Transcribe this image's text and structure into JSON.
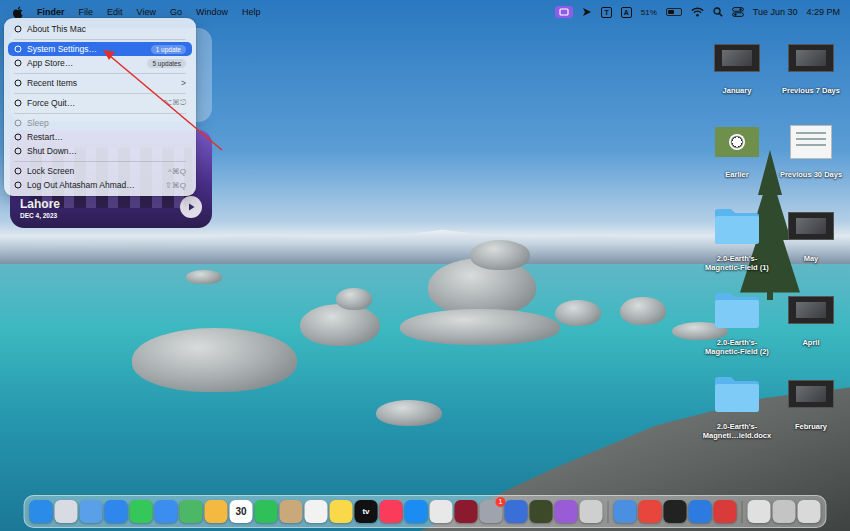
{
  "menu_bar": {
    "app_name": "Finder",
    "menus": [
      "File",
      "Edit",
      "View",
      "Go",
      "Window",
      "Help"
    ],
    "apple_menu_open": true,
    "status": {
      "input_sources": [
        "T",
        "A"
      ],
      "battery": "51%",
      "battery_level": 0.51,
      "date": "Tue Jun 30",
      "time": "4:29 PM"
    }
  },
  "apple_menu": {
    "groups": [
      [
        {
          "label": "About This Mac",
          "selected": false,
          "disabled": false,
          "badge": "",
          "shortcut": "",
          "arrow": ""
        }
      ],
      [
        {
          "label": "System Settings…",
          "selected": true,
          "disabled": false,
          "badge": "1 update",
          "shortcut": "",
          "arrow": ""
        },
        {
          "label": "App Store…",
          "selected": false,
          "disabled": false,
          "badge": "5 updates",
          "shortcut": "",
          "arrow": ""
        }
      ],
      [
        {
          "label": "Recent Items",
          "selected": false,
          "disabled": false,
          "badge": "",
          "shortcut": "",
          "arrow": ">"
        }
      ],
      [
        {
          "label": "Force Quit…",
          "selected": false,
          "disabled": false,
          "badge": "",
          "shortcut": "⌥⌘⎋",
          "arrow": ""
        }
      ],
      [
        {
          "label": "Sleep",
          "selected": false,
          "disabled": true,
          "badge": "",
          "shortcut": "",
          "arrow": ""
        },
        {
          "label": "Restart…",
          "selected": false,
          "disabled": false,
          "badge": "",
          "shortcut": "",
          "arrow": ""
        },
        {
          "label": "Shut Down…",
          "selected": false,
          "disabled": false,
          "badge": "",
          "shortcut": "",
          "arrow": ""
        }
      ],
      [
        {
          "label": "Lock Screen",
          "selected": false,
          "disabled": false,
          "badge": "",
          "shortcut": "^⌘Q",
          "arrow": ""
        },
        {
          "label": "Log Out Ahtasham Ahmad…",
          "selected": false,
          "disabled": false,
          "badge": "",
          "shortcut": "⇧⌘Q",
          "arrow": ""
        }
      ]
    ]
  },
  "widget": {
    "title": "Lahore",
    "date": "DEC 4, 2023"
  },
  "desktop_icons": [
    {
      "label": "January",
      "kind": "video"
    },
    {
      "label": "Previous 7 Days",
      "kind": "video"
    },
    {
      "label": "Earlier",
      "kind": "photo"
    },
    {
      "label": "Previous 30 Days",
      "kind": "document"
    },
    {
      "label": "2.0-Earth's-Magnetic-Field (1)",
      "kind": "folder"
    },
    {
      "label": "May",
      "kind": "video"
    },
    {
      "label": "2.0-Earth's-Magnetic-Field (2)",
      "kind": "folder"
    },
    {
      "label": "April",
      "kind": "video"
    },
    {
      "label": "2.0-Earth's-Magneti…ield.docx",
      "kind": "folder"
    },
    {
      "label": "February",
      "kind": "video"
    }
  ],
  "dock": {
    "apps": [
      {
        "color": "#2a8ce8",
        "text": "",
        "badge": ""
      },
      {
        "color": "#d9dbe2",
        "text": "",
        "badge": ""
      },
      {
        "color": "#5aa0e8",
        "text": "",
        "badge": ""
      },
      {
        "color": "#2f86ec",
        "text": "",
        "badge": ""
      },
      {
        "color": "#35c759",
        "text": "",
        "badge": ""
      },
      {
        "color": "#3b8ef0",
        "text": "",
        "badge": ""
      },
      {
        "color": "#4cb865",
        "text": "",
        "badge": ""
      },
      {
        "color": "#f4b940",
        "text": "",
        "badge": ""
      },
      {
        "color": "#ffffff",
        "text": "30",
        "badge": ""
      },
      {
        "color": "#2fc05a",
        "text": "",
        "badge": ""
      },
      {
        "color": "#c9a97a",
        "text": "",
        "badge": ""
      },
      {
        "color": "#f2f2f2",
        "text": "",
        "badge": ""
      },
      {
        "color": "#f9d94a",
        "text": "",
        "badge": ""
      },
      {
        "color": "#111111",
        "text": "tv",
        "badge": ""
      },
      {
        "color": "#fa3c5a",
        "text": "",
        "badge": ""
      },
      {
        "color": "#1b8df2",
        "text": "",
        "badge": ""
      },
      {
        "color": "#e8e8e8",
        "text": "",
        "badge": ""
      },
      {
        "color": "#8c1a2e",
        "text": "",
        "badge": ""
      },
      {
        "color": "#9ea3ad",
        "text": "",
        "badge": "1"
      },
      {
        "color": "#3b6fd8",
        "text": "",
        "badge": ""
      },
      {
        "color": "#3d4a2a",
        "text": "",
        "badge": ""
      },
      {
        "color": "#9a5cd6",
        "text": "",
        "badge": ""
      },
      {
        "color": "#cfcfcf",
        "text": "",
        "badge": ""
      }
    ],
    "recent": [
      {
        "color": "#4a8fe0",
        "text": "",
        "badge": ""
      },
      {
        "color": "#e8453c",
        "text": "",
        "badge": ""
      },
      {
        "color": "#222222",
        "text": "",
        "badge": ""
      },
      {
        "color": "#2d7be0",
        "text": "",
        "badge": ""
      },
      {
        "color": "#d93a3a",
        "text": "",
        "badge": ""
      }
    ],
    "stacks": [
      {
        "color": "#e0e0e0",
        "text": "",
        "badge": ""
      },
      {
        "color": "#c4c4c4",
        "text": "",
        "badge": ""
      },
      {
        "color": "#d9d9d9",
        "text": "",
        "badge": ""
      }
    ]
  }
}
